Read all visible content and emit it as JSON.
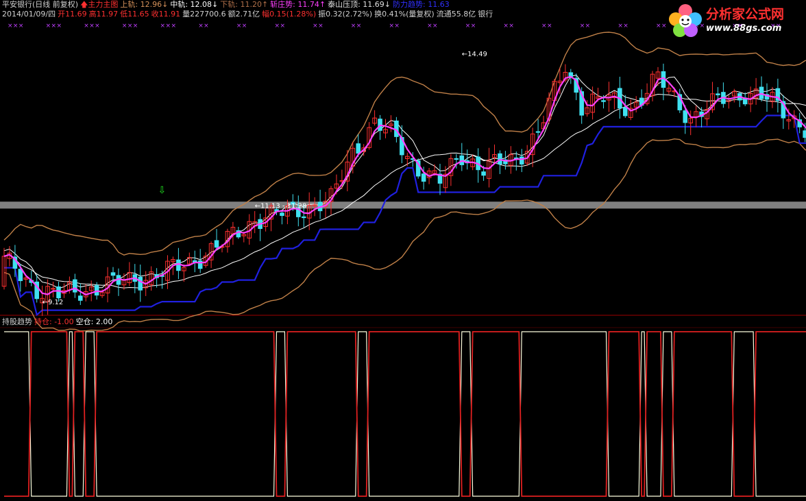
{
  "header": {
    "line1": [
      {
        "text": "平安银行(日线 前复权)",
        "color": "#d0d0d0"
      },
      {
        "text": "🡅主力主图",
        "color": "#ff3030"
      },
      {
        "text": "上轨: 12.96↓",
        "color": "#d4915a"
      },
      {
        "text": "中轨: 12.08↓",
        "color": "#ffffff"
      },
      {
        "text": "下轨: 11.20↑",
        "color": "#b0704a"
      },
      {
        "text": "斩庄势: 11.74↑",
        "color": "#ff40ff"
      },
      {
        "text": "泰山压顶: 11.69↓",
        "color": "#e0e0e0"
      },
      {
        "text": "防力趋势: 11.63",
        "color": "#3030ff"
      }
    ],
    "line2": [
      {
        "text": "2014/01/09/四",
        "color": "#d0d0d0"
      },
      {
        "text": "开11.69",
        "color": "#ff3030"
      },
      {
        "text": "高11.97",
        "color": "#ff3030"
      },
      {
        "text": "低11.65",
        "color": "#ff3030"
      },
      {
        "text": "收11.91",
        "color": "#ff3030"
      },
      {
        "text": "量227700.6",
        "color": "#d0d0d0"
      },
      {
        "text": "额2.71亿",
        "color": "#d0d0d0"
      },
      {
        "text": "幅0.15(1.28%)",
        "color": "#ff3030"
      },
      {
        "text": "振0.32(2.72%)",
        "color": "#d0d0d0"
      },
      {
        "text": "换0.41%(量复权)",
        "color": "#d0d0d0"
      },
      {
        "text": "流通55.8亿",
        "color": "#d0d0d0"
      },
      {
        "text": "银行",
        "color": "#d0d0d0"
      }
    ],
    "indicator": [
      {
        "text": "持股趋势",
        "color": "#d0d0d0"
      },
      {
        "text": "持仓: -1.00",
        "color": "#ff3030"
      },
      {
        "text": "空仓: 2.00",
        "color": "#ffffff"
      }
    ]
  },
  "logo": {
    "title": "分析家公式网",
    "url": "www.88gs.com"
  },
  "chart_data": {
    "type": "candlestick",
    "ylim": [
      8.85,
      15.2
    ],
    "start_price": 9.45,
    "annotations": [
      {
        "text": "14.49",
        "price": 14.49
      },
      {
        "text": "11.13 - 11.28",
        "price": 11.2
      },
      {
        "text": "9.12",
        "price": 9.12
      }
    ],
    "markers": {
      "up": "#ff3030",
      "down": "#40e0f0",
      "ma_pink": "#ff40ff",
      "trend_blue": "#2020e0",
      "band": "#c08048",
      "gray_band": "#808080"
    },
    "waypoints": [
      [
        0,
        10.0
      ],
      [
        6,
        9.4
      ],
      [
        10,
        9.25
      ],
      [
        16,
        9.4
      ],
      [
        26,
        9.65
      ],
      [
        32,
        9.85
      ],
      [
        40,
        10.35
      ],
      [
        46,
        10.9
      ],
      [
        52,
        11.05
      ],
      [
        60,
        11.3
      ],
      [
        64,
        12.35
      ],
      [
        68,
        13.0
      ],
      [
        72,
        12.6
      ],
      [
        76,
        12.0
      ],
      [
        80,
        11.7
      ],
      [
        84,
        12.3
      ],
      [
        88,
        12.0
      ],
      [
        94,
        12.2
      ],
      [
        98,
        12.8
      ],
      [
        103,
        14.2
      ],
      [
        106,
        13.4
      ],
      [
        110,
        13.5
      ],
      [
        115,
        13.3
      ],
      [
        120,
        13.95
      ],
      [
        126,
        13.1
      ],
      [
        132,
        13.5
      ],
      [
        136,
        13.65
      ],
      [
        140,
        13.5
      ],
      [
        146,
        13.0
      ],
      [
        152,
        12.3
      ],
      [
        158,
        11.9
      ],
      [
        162,
        11.6
      ],
      [
        166,
        11.95
      ],
      [
        170,
        11.75
      ],
      [
        172,
        11.95
      ]
    ],
    "positions": {
      "legend": [
        "持仓",
        "空仓"
      ],
      "hold_value": -1.0,
      "empty_value": 2.0,
      "segments": [
        [
          0,
          0
        ],
        [
          5,
          1
        ],
        [
          12,
          0
        ],
        [
          13,
          1
        ],
        [
          15,
          0
        ],
        [
          17,
          1
        ],
        [
          50,
          0
        ],
        [
          52,
          1
        ],
        [
          65,
          0
        ],
        [
          67,
          1
        ],
        [
          84,
          0
        ],
        [
          86,
          1
        ],
        [
          95,
          0
        ],
        [
          111,
          1
        ],
        [
          117,
          0
        ],
        [
          118,
          1
        ],
        [
          121,
          0
        ],
        [
          123,
          1
        ],
        [
          134,
          0
        ],
        [
          138,
          1
        ],
        [
          164,
          0
        ],
        [
          170,
          1
        ],
        [
          172,
          1
        ]
      ]
    }
  }
}
